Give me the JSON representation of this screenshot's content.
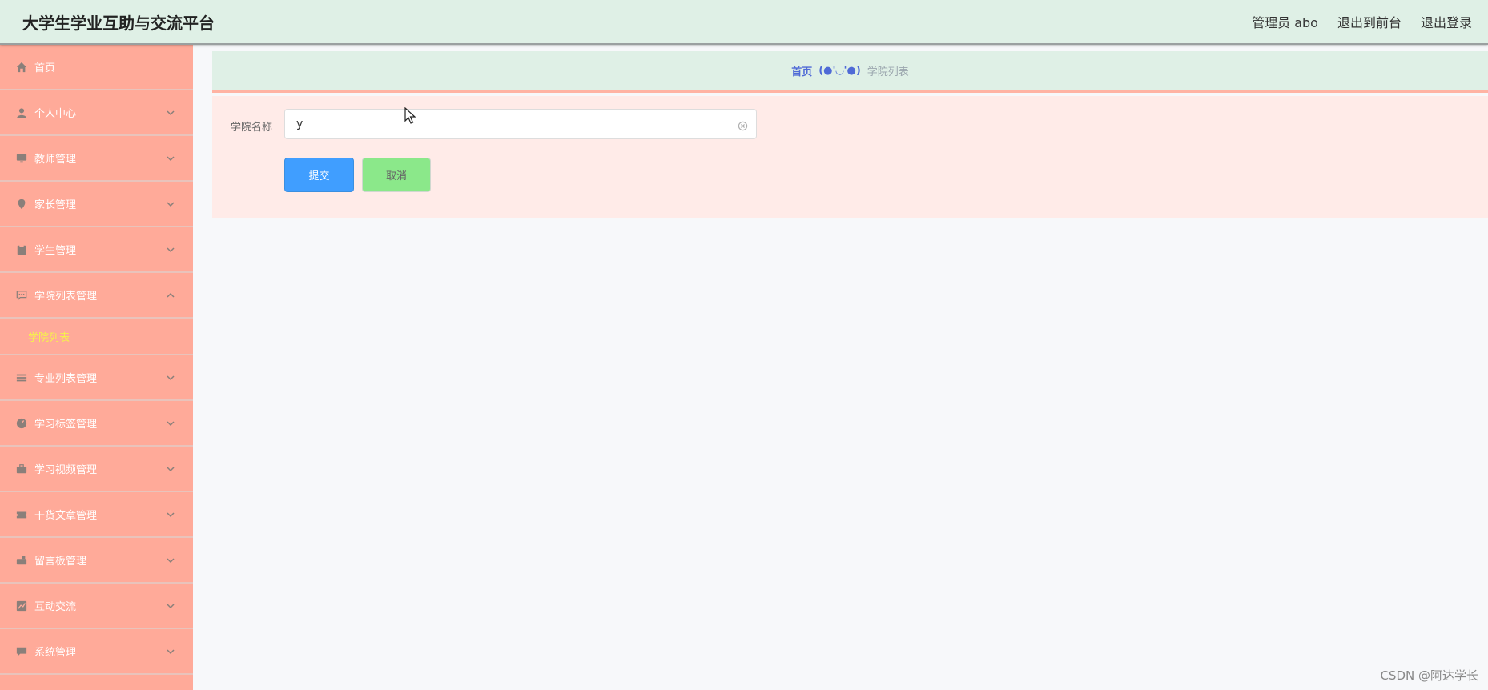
{
  "app": {
    "title": "大学生学业互助与交流平台",
    "user_label": "管理员 abo",
    "back_to_front": "退出到前台",
    "logout": "退出登录"
  },
  "sidebar": {
    "items": [
      {
        "label": "首页",
        "icon": "home-icon",
        "has_arrow": false
      },
      {
        "label": "个人中心",
        "icon": "user-icon",
        "has_arrow": true
      },
      {
        "label": "教师管理",
        "icon": "monitor-icon",
        "has_arrow": true
      },
      {
        "label": "家长管理",
        "icon": "location-icon",
        "has_arrow": true
      },
      {
        "label": "学生管理",
        "icon": "clipboard-icon",
        "has_arrow": true
      },
      {
        "label": "学院列表管理",
        "icon": "chat-icon",
        "has_arrow": true,
        "expanded": true
      },
      {
        "label": "专业列表管理",
        "icon": "list-icon",
        "has_arrow": true
      },
      {
        "label": "学习标签管理",
        "icon": "gauge-icon",
        "has_arrow": true
      },
      {
        "label": "学习视频管理",
        "icon": "briefcase-icon",
        "has_arrow": true
      },
      {
        "label": "干货文章管理",
        "icon": "ticket-icon",
        "has_arrow": true
      },
      {
        "label": "留言板管理",
        "icon": "mailbox-icon",
        "has_arrow": true
      },
      {
        "label": "互动交流",
        "icon": "chart-icon",
        "has_arrow": true
      },
      {
        "label": "系统管理",
        "icon": "message-icon",
        "has_arrow": true
      }
    ],
    "submenu": {
      "label": "学院列表"
    }
  },
  "breadcrumb": {
    "home": "首页",
    "separator": "(●'◡'●)",
    "current": "学院列表"
  },
  "form": {
    "field_label": "学院名称",
    "field_value": "y",
    "submit_label": "提交",
    "cancel_label": "取消"
  },
  "watermark": "CSDN @阿达学长",
  "colors": {
    "sidebar_bg": "#ffaa99",
    "topbar_bg": "#dff0e6",
    "submit_bg": "#409eff",
    "cancel_bg": "#8be88a",
    "submenu_text": "#f6f34a"
  }
}
